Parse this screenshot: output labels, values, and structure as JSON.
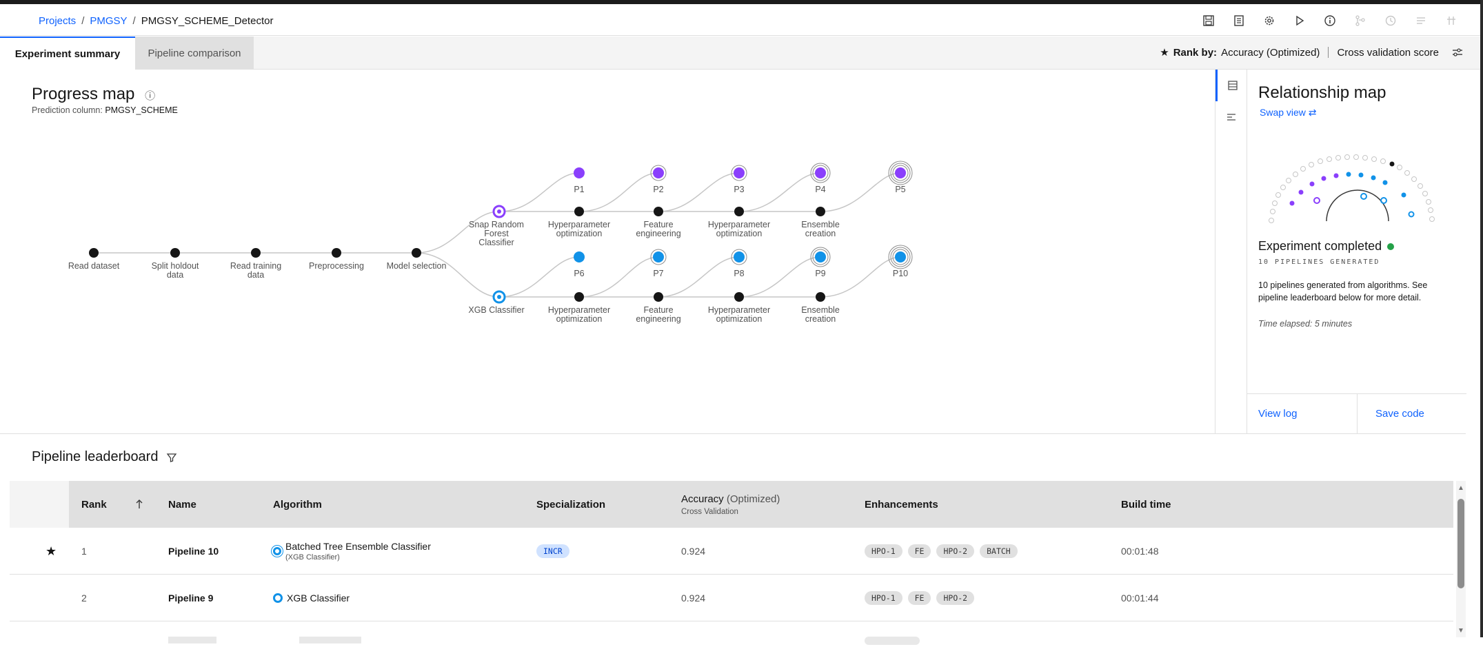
{
  "breadcrumb": {
    "project": "Projects",
    "sep1": "/",
    "group": "PMGSY",
    "sep2": "/",
    "current": "PMGSY_SCHEME_Detector"
  },
  "toolbar": [
    "save-icon",
    "notebook-icon",
    "settings-icon",
    "play-icon",
    "info-icon",
    "branch-icon",
    "history-icon",
    "list-icon",
    "grid-icon"
  ],
  "tabs": {
    "summary": "Experiment summary",
    "comparison": "Pipeline comparison"
  },
  "rank_by": {
    "star": "★",
    "label": "Rank by:",
    "metric": "Accuracy (Optimized)",
    "score": "Cross validation score"
  },
  "progress_map": {
    "title": "Progress map",
    "info": "ⓘ",
    "prediction_label": "Prediction column:",
    "prediction_value": "PMGSY_SCHEME",
    "steps": [
      "Read dataset",
      "Split holdout",
      "data",
      "Read training",
      "data",
      "Preprocessing",
      "Model selection"
    ],
    "algo_top": [
      "Snap Random",
      "Forest",
      "Classifier"
    ],
    "algo_bottom": "XGB Classifier",
    "stage_labels": [
      "Hyperparameter",
      "optimization",
      "Feature",
      "engineering",
      "Hyperparameter",
      "optimization",
      "Ensemble",
      "creation"
    ],
    "pipelines_top": [
      "P1",
      "P2",
      "P3",
      "P4",
      "P5"
    ],
    "pipelines_bottom": [
      "P6",
      "P7",
      "P8",
      "P9",
      "P10"
    ],
    "colors": {
      "snap": "#8a3ffc",
      "xgb": "#1192e8",
      "node": "#161616",
      "line": "#c6c6c6"
    }
  },
  "relationship_map": {
    "title": "Relationship map",
    "swap": "Swap view ⇄",
    "status": "Experiment completed",
    "pipelines_generated": "10 PIPELINES GENERATED",
    "description": "10 pipelines generated from algorithms. See pipeline leaderboard below for more detail.",
    "elapsed": "Time elapsed: 5 minutes",
    "view_log": "View log",
    "save_code": "Save code"
  },
  "leaderboard": {
    "title": "Pipeline leaderboard",
    "columns": {
      "rank": "Rank",
      "name": "Name",
      "algorithm": "Algorithm",
      "specialization": "Specialization",
      "accuracy": "Accuracy",
      "accuracy_opt": "(Optimized)",
      "accuracy_sub": "Cross Validation",
      "enhancements": "Enhancements",
      "build_time": "Build time"
    },
    "rows": [
      {
        "star": "★",
        "rank": "1",
        "name": "Pipeline 10",
        "algorithm": "Batched Tree Ensemble Classifier",
        "algorithm_sub": "(XGB Classifier)",
        "specialization": "INCR",
        "accuracy": "0.924",
        "enhancements": [
          "HPO-1",
          "FE",
          "HPO-2",
          "BATCH"
        ],
        "build_time": "00:01:48"
      },
      {
        "star": "",
        "rank": "2",
        "name": "Pipeline 9",
        "algorithm": "XGB Classifier",
        "algorithm_sub": "",
        "specialization": "",
        "accuracy": "0.924",
        "enhancements": [
          "HPO-1",
          "FE",
          "HPO-2"
        ],
        "build_time": "00:01:44"
      }
    ]
  }
}
